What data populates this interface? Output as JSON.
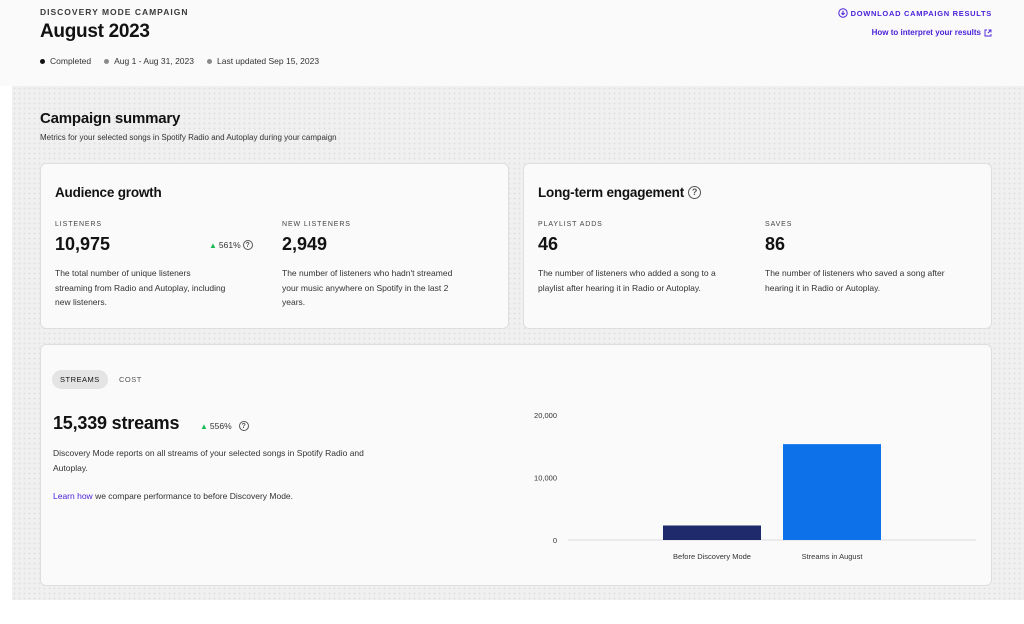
{
  "header": {
    "eyebrow": "DISCOVERY MODE CAMPAIGN",
    "title": "August 2023",
    "status": "Completed",
    "date_range": "Aug 1 - Aug 31, 2023",
    "last_updated": "Last updated Sep 15, 2023",
    "download_label": "DOWNLOAD CAMPAIGN RESULTS",
    "howto_label": "How to interpret your results"
  },
  "summary": {
    "title": "Campaign summary",
    "subtitle": "Metrics for your selected songs in Spotify Radio and Autoplay during your campaign"
  },
  "audience": {
    "title": "Audience growth",
    "listeners_label": "LISTENERS",
    "listeners_value": "10,975",
    "listeners_delta": "561%",
    "listeners_desc_1": "The total number of unique listeners",
    "listeners_desc_2": "streaming from Radio and Autoplay, including",
    "listeners_desc_3": "new listeners.",
    "new_label": "NEW LISTENERS",
    "new_value": "2,949",
    "new_desc_1": "The number of listeners who hadn't streamed",
    "new_desc_2": "your music anywhere on Spotify in the last 2",
    "new_desc_3": "years."
  },
  "engagement": {
    "title": "Long-term engagement",
    "playlist_label": "PLAYLIST ADDS",
    "playlist_value": "46",
    "playlist_desc_1": "The number of listeners who added a song to a",
    "playlist_desc_2": "playlist after hearing it in Radio or Autoplay.",
    "saves_label": "SAVES",
    "saves_value": "86",
    "saves_desc_1": "The number of listeners who saved a song after",
    "saves_desc_2": "hearing it in Radio or Autoplay."
  },
  "streams_card": {
    "tab_streams": "STREAMS",
    "tab_cost": "COST",
    "streams_value": "15,339 streams",
    "streams_delta": "556%",
    "desc_1": "Discovery Mode reports on all streams of your selected songs in Spotify Radio and",
    "desc_2": "Autoplay.",
    "learn_link": "Learn how",
    "learn_rest": " we compare performance to before Discovery Mode."
  },
  "colors": {
    "accent": "#4b22d9",
    "positive": "#1db954",
    "bar_before": "#1e2a6b",
    "bar_august": "#0d72ea"
  },
  "chart_data": {
    "type": "bar",
    "categories": [
      "Before Discovery Mode",
      "Streams in August"
    ],
    "values": [
      2320,
      15339
    ],
    "ylim": [
      0,
      20000
    ],
    "yticks": [
      0,
      10000,
      20000
    ],
    "ytick_labels": [
      "0",
      "10,000",
      "20,000"
    ],
    "grid": false,
    "legend": "none"
  }
}
